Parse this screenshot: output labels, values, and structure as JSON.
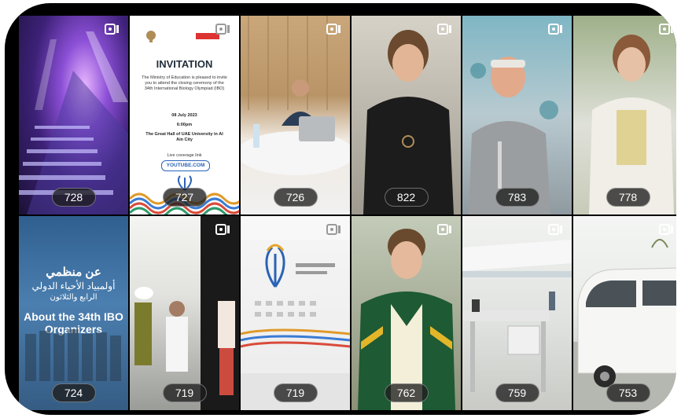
{
  "tiles": [
    {
      "view_count": "728"
    },
    {
      "view_count": "727",
      "invitation": {
        "title": "INVITATION",
        "body": "The Ministry of Education is pleased to invite you to attend the closing ceremony of the 34th International Biology Olympiad (IBO)",
        "date": "08 July 2023",
        "time": "6:00pm",
        "venue": "The Great Hall of UAE University in Al Ain City",
        "live_label": "Live coverage link",
        "link": "YOUTUBE.COM"
      }
    },
    {
      "view_count": "726"
    },
    {
      "view_count": "822"
    },
    {
      "view_count": "783"
    },
    {
      "view_count": "778"
    },
    {
      "view_count": "724",
      "organizers": {
        "arabic_line1": "عن منظمي",
        "arabic_line2": "أولمبياد الأحياء الدولي",
        "arabic_line3": "الرابع والثلاثون",
        "english": "About the 34th IBO Organizers"
      }
    },
    {
      "view_count": "719"
    },
    {
      "view_count": "719"
    },
    {
      "view_count": "762"
    },
    {
      "view_count": "759"
    },
    {
      "view_count": "753"
    }
  ],
  "icons": {
    "reel": "reel-icon"
  },
  "colors": {
    "frame": "#000000",
    "badge_bg": "#1e1e1e"
  }
}
